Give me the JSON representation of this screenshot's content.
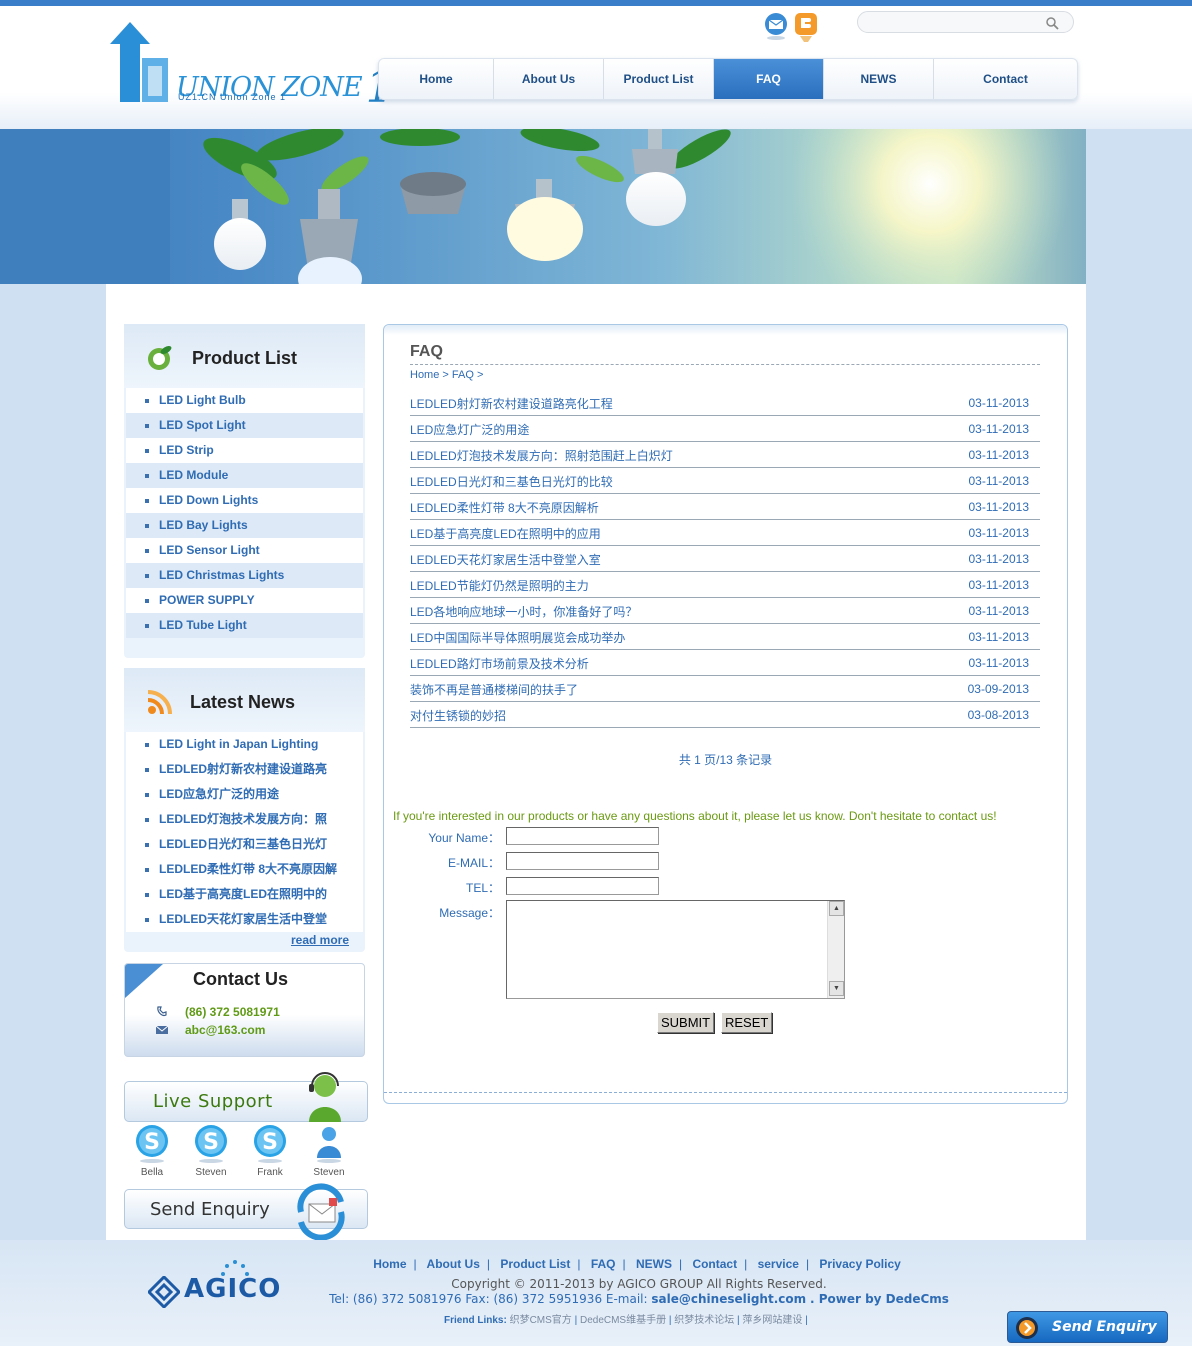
{
  "header": {
    "logo_text": "UNION ZONE",
    "logo_number": "1",
    "logo_tagline": "UZ1.CN Union Zone 1",
    "icons": [
      "email-icon",
      "blogger-icon"
    ],
    "search_placeholder": ""
  },
  "nav": {
    "items": [
      {
        "label": "Home"
      },
      {
        "label": "About Us"
      },
      {
        "label": "Product List"
      },
      {
        "label": "FAQ"
      },
      {
        "label": "NEWS"
      },
      {
        "label": "Contact"
      }
    ],
    "active": "FAQ"
  },
  "sidebar": {
    "products": {
      "title": "Product List",
      "items": [
        "LED Light Bulb",
        "LED Spot Light",
        "LED Strip",
        "LED Module",
        "LED Down Lights",
        "LED Bay Lights",
        "LED Sensor Light",
        "LED Christmas Lights",
        "POWER SUPPLY",
        "LED Tube Light"
      ]
    },
    "news": {
      "title": "Latest News",
      "items": [
        "LED Light in Japan Lighting",
        "LEDLED射灯新农村建设道路亮",
        "LED应急灯广泛的用途",
        "LEDLED灯泡技术发展方向：照",
        "LEDLED日光灯和三基色日光灯",
        "LEDLED柔性灯带 8大不亮原因解",
        "LED基于高亮度LED在照明中的",
        "LEDLED天花灯家居生活中登堂"
      ],
      "more": "read more"
    },
    "contact": {
      "title": "Contact Us",
      "phone": "(86) 372 5081971",
      "email": "abc@163.com"
    },
    "live_support": {
      "title": "Live Support",
      "agents": [
        "Bella",
        "Steven",
        "Frank",
        "Steven"
      ]
    },
    "send_enquiry": "Send Enquiry"
  },
  "main": {
    "title": "FAQ",
    "breadcrumb": "Home > FAQ >",
    "faq": [
      {
        "title": "LEDLED射灯新农村建设道路亮化工程",
        "date": "03-11-2013"
      },
      {
        "title": "LED应急灯广泛的用途",
        "date": "03-11-2013"
      },
      {
        "title": "LEDLED灯泡技术发展方向：照射范围赶上白炽灯",
        "date": "03-11-2013"
      },
      {
        "title": "LEDLED日光灯和三基色日光灯的比较",
        "date": "03-11-2013"
      },
      {
        "title": "LEDLED柔性灯带 8大不亮原因解析",
        "date": "03-11-2013"
      },
      {
        "title": "LED基于高亮度LED在照明中的应用",
        "date": "03-11-2013"
      },
      {
        "title": "LEDLED天花灯家居生活中登堂入室",
        "date": "03-11-2013"
      },
      {
        "title": "LEDLED节能灯仍然是照明的主力",
        "date": "03-11-2013"
      },
      {
        "title": "LED各地响应地球一小时，你准备好了吗？",
        "date": "03-11-2013"
      },
      {
        "title": "LED中国国际半导体照明展览会成功举办",
        "date": "03-11-2013"
      },
      {
        "title": "LEDLED路灯市场前景及技术分析",
        "date": "03-11-2013"
      },
      {
        "title": "装饰不再是普通楼梯间的扶手了",
        "date": "03-09-2013"
      },
      {
        "title": "对付生锈锁的妙招",
        "date": "03-08-2013"
      }
    ],
    "pager": "共 1 页/13 条记录",
    "form": {
      "intro": "If you're interested in our products or have any questions about it, please let us know. Don't hesitate to contact us!",
      "name_label": "Your Name：",
      "email_label": "E-MAIL：",
      "tel_label": "TEL：",
      "message_label": "Message：",
      "submit": "SUBMIT",
      "reset": "RESET"
    }
  },
  "footer": {
    "brand": "AGICO",
    "links": [
      "Home",
      "About Us",
      "Product List",
      "FAQ",
      "NEWS",
      "Contact",
      "service",
      "Privacy Policy"
    ],
    "copyright": "Copyright © 2011-2013 by AGICO GROUP All Rights Reserved.",
    "contact_prefix": "Tel: (86) 372 5081976 Fax: (86) 372 5951936 E-mail:",
    "contact_email": "sale@chineselight.com",
    "powered": ". Power by DedeCms",
    "friend_label": "Friend Links:",
    "friend_links": [
      "织梦CMS官方",
      "DedeCMS维基手册",
      "织梦技术论坛",
      "萍乡网站建设"
    ],
    "float_enquiry": "Send Enquiry"
  },
  "colors": {
    "accent": "#2f6cb4",
    "nav_active": "#2a6fbd",
    "green_text": "#6a9a12",
    "page_side": "#cfe0f3"
  }
}
